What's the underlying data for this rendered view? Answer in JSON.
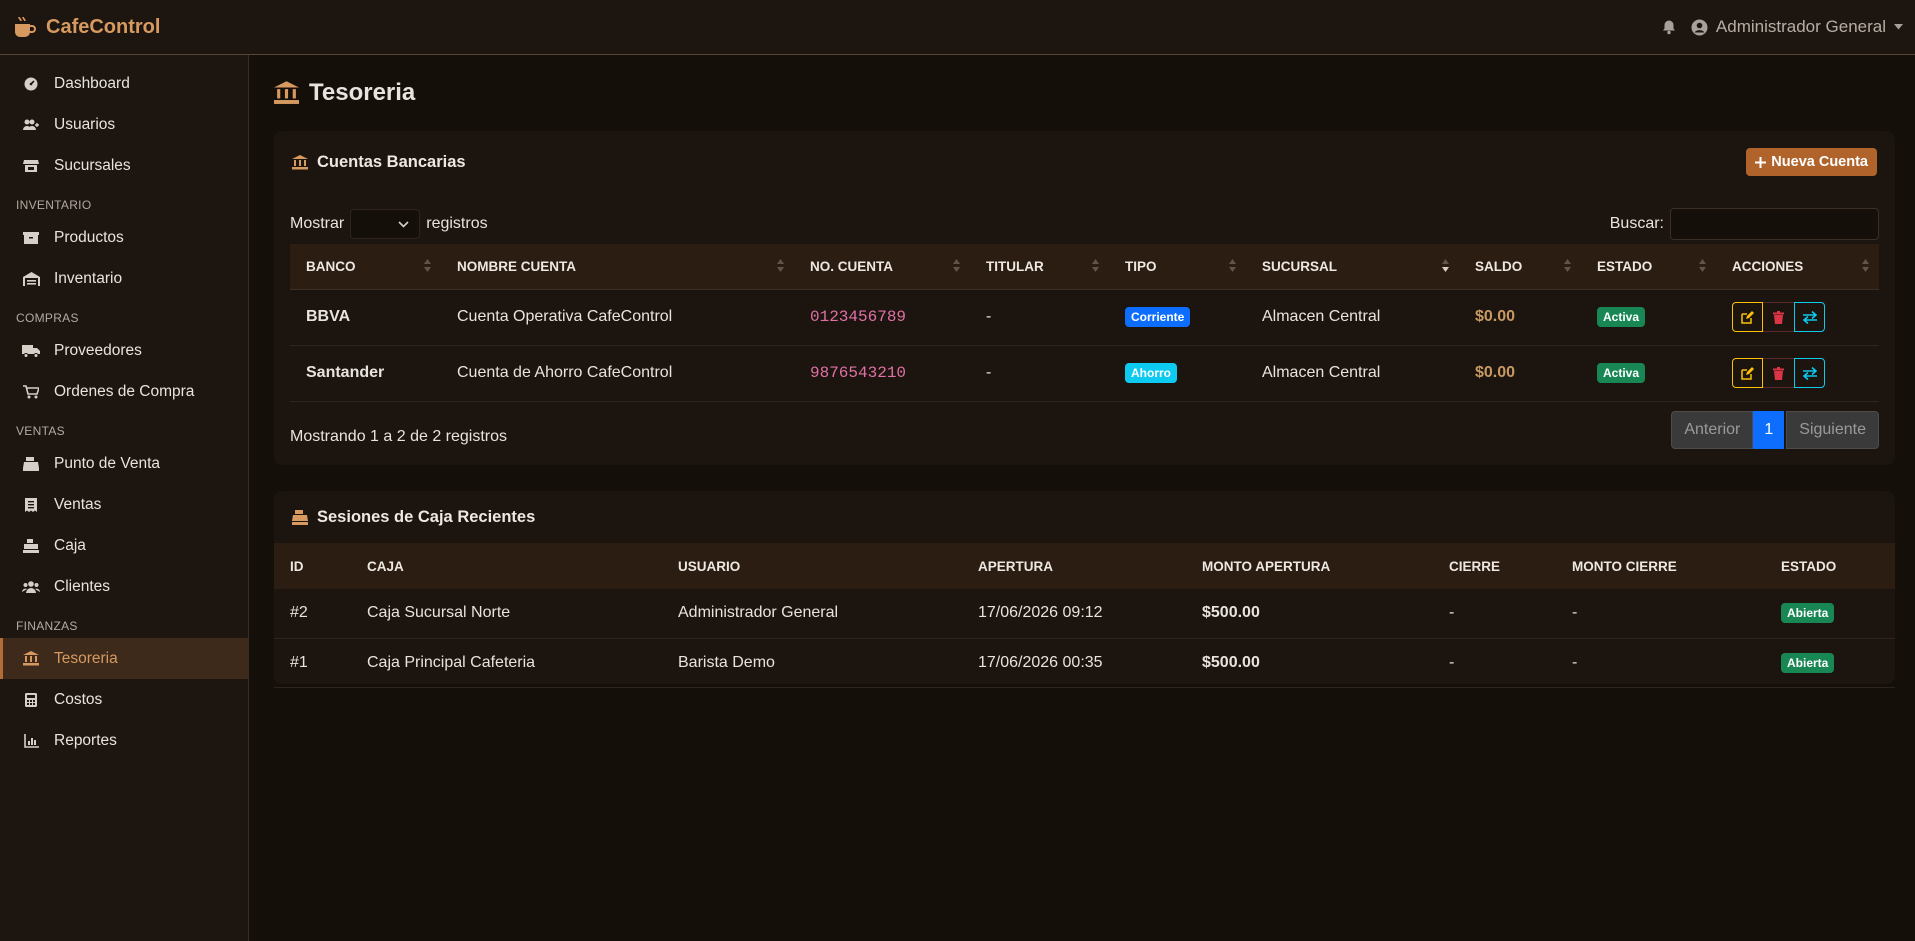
{
  "app": {
    "brand": "CafeControl"
  },
  "topbar": {
    "user_name": "Administrador General"
  },
  "sidebar": {
    "groups": [
      {
        "label": "",
        "items": [
          {
            "label": "Dashboard",
            "icon": "dashboard-icon"
          },
          {
            "label": "Usuarios",
            "icon": "users-icon"
          },
          {
            "label": "Sucursales",
            "icon": "store-icon"
          }
        ]
      },
      {
        "label": "INVENTARIO",
        "items": [
          {
            "label": "Productos",
            "icon": "box-icon"
          },
          {
            "label": "Inventario",
            "icon": "warehouse-icon"
          }
        ]
      },
      {
        "label": "COMPRAS",
        "items": [
          {
            "label": "Proveedores",
            "icon": "truck-icon"
          },
          {
            "label": "Ordenes de Compra",
            "icon": "cart-icon"
          }
        ]
      },
      {
        "label": "VENTAS",
        "items": [
          {
            "label": "Punto de Venta",
            "icon": "cash-register-icon"
          },
          {
            "label": "Ventas",
            "icon": "receipt-icon"
          },
          {
            "label": "Caja",
            "icon": "cash-drawer-icon"
          },
          {
            "label": "Clientes",
            "icon": "clients-icon"
          }
        ]
      },
      {
        "label": "FINANZAS",
        "items": [
          {
            "label": "Tesoreria",
            "icon": "bank-icon",
            "active": true
          },
          {
            "label": "Costos",
            "icon": "calculator-icon"
          },
          {
            "label": "Reportes",
            "icon": "chart-icon"
          }
        ]
      }
    ]
  },
  "page": {
    "title": "Tesoreria"
  },
  "accounts": {
    "title": "Cuentas Bancarias",
    "new_button": "Nueva Cuenta",
    "show_label": "Mostrar",
    "records_label": "registros",
    "search_label": "Buscar:",
    "search_value": "",
    "columns": [
      "BANCO",
      "NOMBRE CUENTA",
      "NO. CUENTA",
      "TITULAR",
      "TIPO",
      "SUCURSAL",
      "SALDO",
      "ESTADO",
      "ACCIONES"
    ],
    "rows": [
      {
        "bank": "BBVA",
        "name": "Cuenta Operativa CafeControl",
        "number": "0123456789",
        "holder": "-",
        "type": "Corriente",
        "branch": "Almacen Central",
        "balance": "$0.00",
        "status": "Activa"
      },
      {
        "bank": "Santander",
        "name": "Cuenta de Ahorro CafeControl",
        "number": "9876543210",
        "holder": "-",
        "type": "Ahorro",
        "branch": "Almacen Central",
        "balance": "$0.00",
        "status": "Activa"
      }
    ],
    "info": "Mostrando 1 a 2 de 2 registros",
    "pager": {
      "prev": "Anterior",
      "current": "1",
      "next": "Siguiente"
    }
  },
  "sessions": {
    "title": "Sesiones de Caja Recientes",
    "columns": [
      "ID",
      "CAJA",
      "USUARIO",
      "APERTURA",
      "MONTO APERTURA",
      "CIERRE",
      "MONTO CIERRE",
      "ESTADO"
    ],
    "rows": [
      {
        "id": "#2",
        "box": "Caja Sucursal Norte",
        "user": "Administrador General",
        "opened": "17/06/2026 09:12",
        "open_amount": "$500.00",
        "closed": "-",
        "close_amount": "-",
        "status": "Abierta"
      },
      {
        "id": "#1",
        "box": "Caja Principal Cafeteria",
        "user": "Barista Demo",
        "opened": "17/06/2026 00:35",
        "open_amount": "$500.00",
        "closed": "-",
        "close_amount": "-",
        "status": "Abierta"
      }
    ]
  },
  "colors": {
    "accent": "#d69a60",
    "button": "#b0642c",
    "background": "#150f0a",
    "panel": "#1c140e"
  }
}
